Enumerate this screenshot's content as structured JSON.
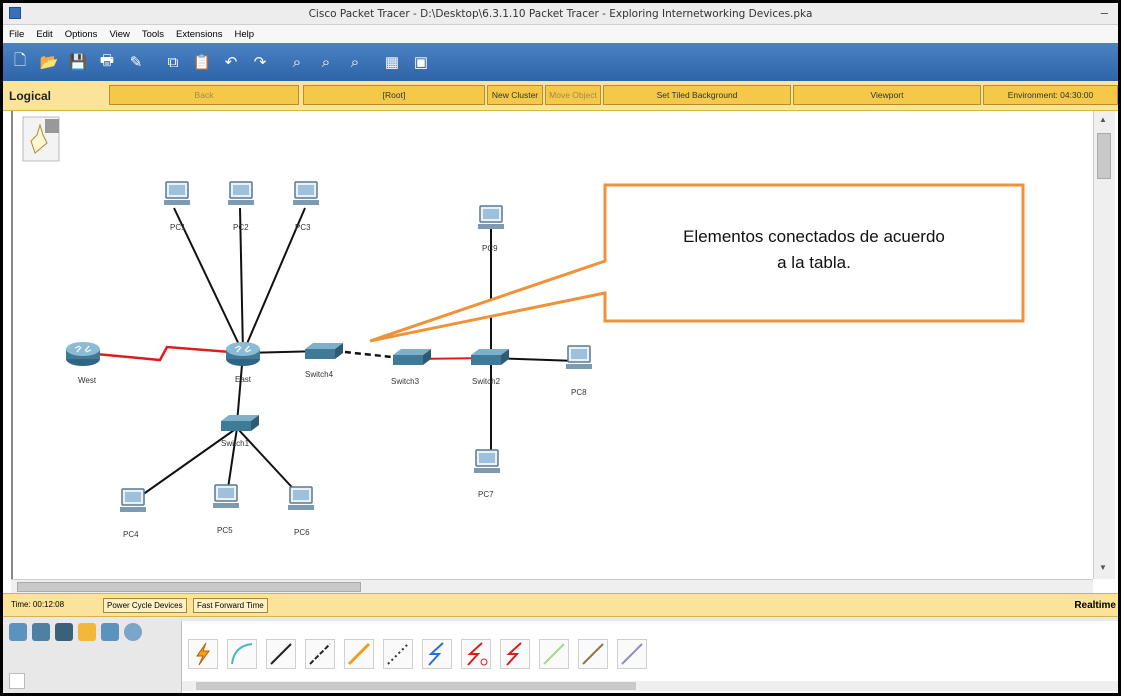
{
  "window": {
    "title": "Cisco Packet Tracer - D:\\Desktop\\6.3.1.10 Packet Tracer - Exploring Internetworking Devices.pka"
  },
  "menu": [
    "File",
    "Edit",
    "Options",
    "View",
    "Tools",
    "Extensions",
    "Help"
  ],
  "logicalbar": {
    "label": "Logical",
    "back": "Back",
    "root": "[Root]",
    "new_cluster": "New Cluster",
    "move_object": "Move Object",
    "set_tiled_background": "Set Tiled Background",
    "viewport": "Viewport",
    "environment": "Environment: 04:30:00"
  },
  "topology": {
    "devices": {
      "pc1": "PC1",
      "pc2": "PC2",
      "pc3": "PC3",
      "pc4": "PC4",
      "pc5": "PC5",
      "pc6": "PC6",
      "pc7": "PC7",
      "pc8": "PC8",
      "pc9": "PC9",
      "west": "West",
      "east": "East",
      "switch1": "Switch1",
      "switch2": "Switch2",
      "switch3": "Switch3",
      "switch4": "Switch4"
    },
    "callout": {
      "line1": "Elementos conectados de acuerdo",
      "line2": "a la tabla."
    }
  },
  "statusbar": {
    "time": "Time: 00:12:08",
    "power_cycle": "Power Cycle Devices",
    "fast_forward": "Fast Forward Time",
    "mode": "Realtime"
  },
  "colors": {
    "toolbar": "#2e64a8",
    "logical_bar": "#fbe49a",
    "serial_link": "#d91e1e",
    "callout_border": "#f0923a"
  }
}
